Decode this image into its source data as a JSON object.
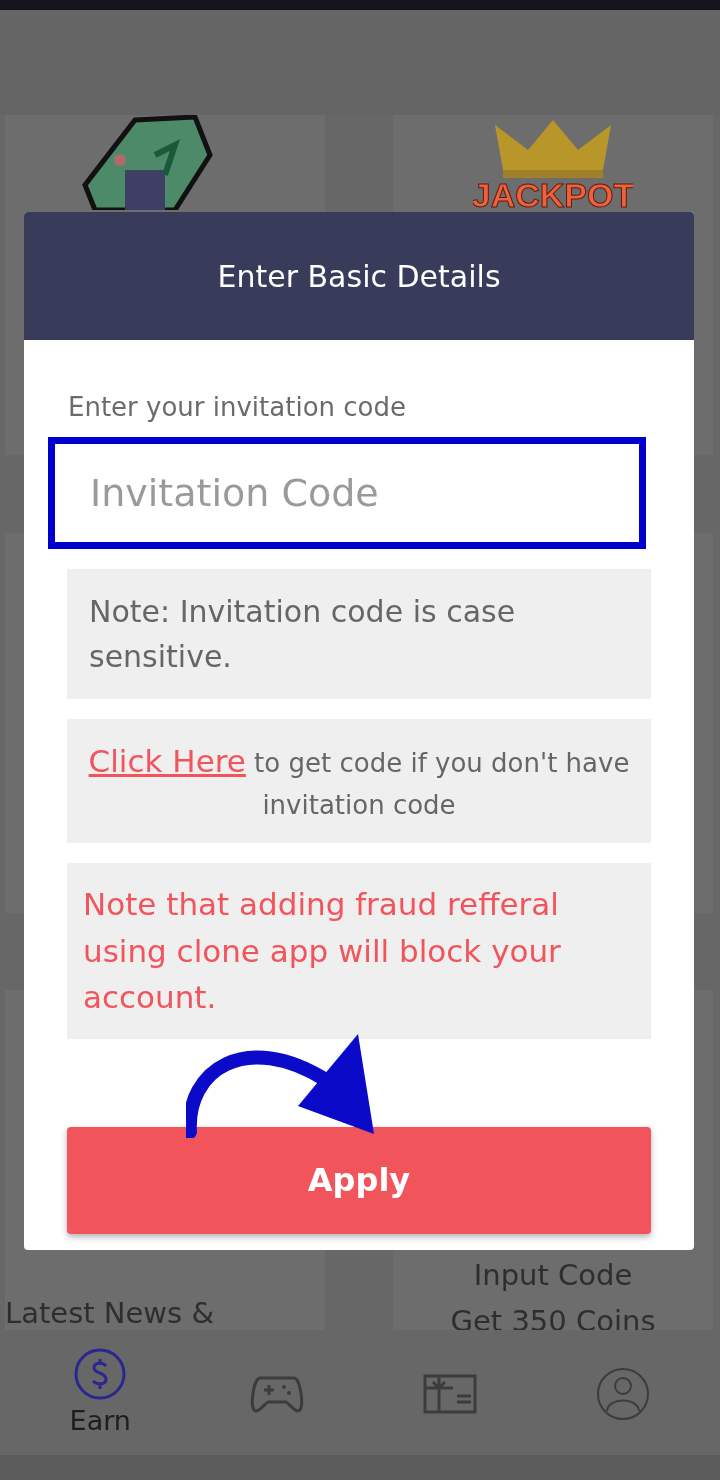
{
  "cards": [
    {
      "kind": "ticket"
    },
    {
      "kind": "jackpot",
      "art_text": "JACKPOT"
    },
    {
      "kind": "blank"
    },
    {
      "kind": "blank"
    },
    {
      "kind": "text",
      "title": "Latest News &"
    },
    {
      "kind": "text",
      "title": "Input Code",
      "subtitle": "Get 350 Coins"
    }
  ],
  "dialog": {
    "title": "Enter Basic Details",
    "label": "Enter your invitation code",
    "field": {
      "placeholder": "Invitation Code"
    },
    "notes": [
      {
        "kind": "plain",
        "text": "Note: Invitation code is case sensitive."
      },
      {
        "kind": "link",
        "link": "Click Here",
        "text": "to get code if you don't have invitation code"
      },
      {
        "kind": "warning",
        "text": "Note that adding fraud refferal using clone app will block your account."
      }
    ],
    "button": "Apply"
  },
  "nav": [
    {
      "kind": "dollar",
      "label": "Earn",
      "selected": true
    },
    {
      "kind": "gamepad",
      "selected": false
    },
    {
      "kind": "giftcard",
      "selected": false
    },
    {
      "kind": "profile",
      "selected": false
    }
  ]
}
